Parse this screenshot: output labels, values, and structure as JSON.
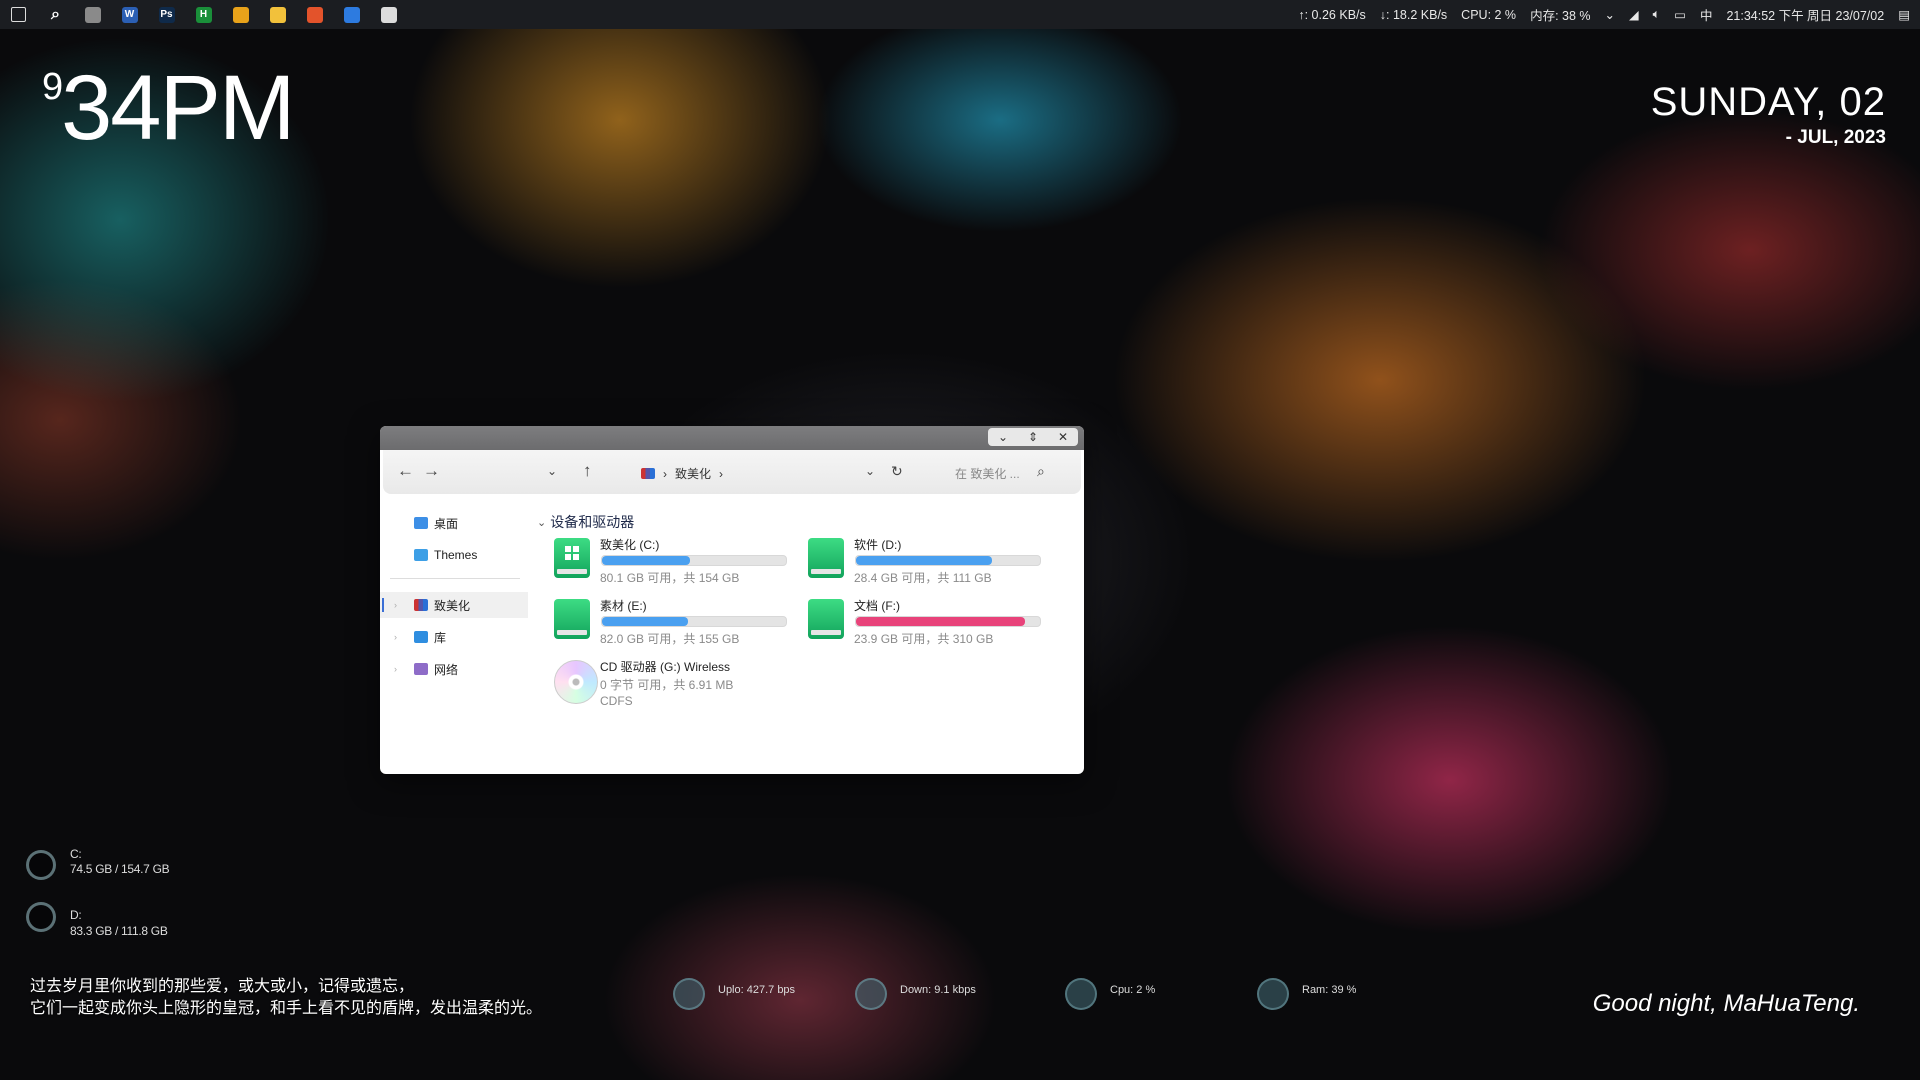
{
  "taskbar": {
    "apps": [
      {
        "name": "start-icon",
        "glyph": "",
        "bg": "transparent"
      },
      {
        "name": "search-icon",
        "glyph": "",
        "bg": "transparent"
      },
      {
        "name": "task-view-icon",
        "glyph": "",
        "bg": "#8a8a8a"
      },
      {
        "name": "word-icon",
        "glyph": "W",
        "bg": "#2b5fb4"
      },
      {
        "name": "photoshop-icon",
        "glyph": "Ps",
        "bg": "#0f2a4a"
      },
      {
        "name": "app-h-icon",
        "glyph": "H",
        "bg": "#1a8f3a"
      },
      {
        "name": "chrome-icon",
        "glyph": "",
        "bg": "#e8a21a"
      },
      {
        "name": "file-explorer-icon",
        "glyph": "",
        "bg": "#f2c13b"
      },
      {
        "name": "firefox-icon",
        "glyph": "",
        "bg": "#e3532b"
      },
      {
        "name": "app-blue-icon",
        "glyph": "",
        "bg": "#2d7be0"
      },
      {
        "name": "notepad-icon",
        "glyph": "",
        "bg": "#dcdcdc"
      }
    ],
    "upload": "↑: 0.26 KB/s",
    "download": "↓: 18.2 KB/s",
    "cpu": "CPU: 2 %",
    "memory": "内存: 38 %",
    "ime": "中",
    "clock": "21:34:52 下午 周日 23/07/02"
  },
  "clock": {
    "hour_small": "9",
    "main": "34PM"
  },
  "date": {
    "day": "SUNDAY, 02",
    "month": "- JUL, 2023"
  },
  "explorer": {
    "address": "致美化",
    "search_placeholder": "在 致美化 ...",
    "sidebar": [
      "桌面",
      "Themes",
      "致美化",
      "库",
      "网络"
    ],
    "section": "设备和驱动器",
    "drives": [
      {
        "name": "致美化 (C:)",
        "info": "80.1 GB 可用，共 154 GB",
        "used": 0.48,
        "color": "#4aa0f0"
      },
      {
        "name": "软件 (D:)",
        "info": "28.4 GB 可用，共 111 GB",
        "used": 0.74,
        "color": "#4aa0f0"
      },
      {
        "name": "素材 (E:)",
        "info": "82.0 GB 可用，共 155 GB",
        "used": 0.47,
        "color": "#4aa0f0"
      },
      {
        "name": "文档 (F:)",
        "info": "23.9 GB 可用，共 310 GB",
        "used": 0.92,
        "color": "#e8437a"
      }
    ],
    "cd": {
      "name": "CD 驱动器 (G:) Wireless",
      "info": "0 字节 可用，共 6.91 MB",
      "fs": "CDFS"
    }
  },
  "disks": [
    {
      "label": "C:",
      "value": "74.5 GB / 154.7 GB"
    },
    {
      "label": "D:",
      "value": "83.3 GB / 111.8 GB"
    }
  ],
  "quote": [
    "过去岁月里你收到的那些爱，或大或小，记得或遗忘，",
    "它们一起变成你头上隐形的皇冠，和手上看不见的盾牌，发出温柔的光。"
  ],
  "stats": [
    {
      "label": "Uplo: 427.7 bps"
    },
    {
      "label": "Down: 9.1 kbps"
    },
    {
      "label": "Cpu: 2 %"
    },
    {
      "label": "Ram: 39 %"
    }
  ],
  "greeting": "Good night, MaHuaTeng."
}
